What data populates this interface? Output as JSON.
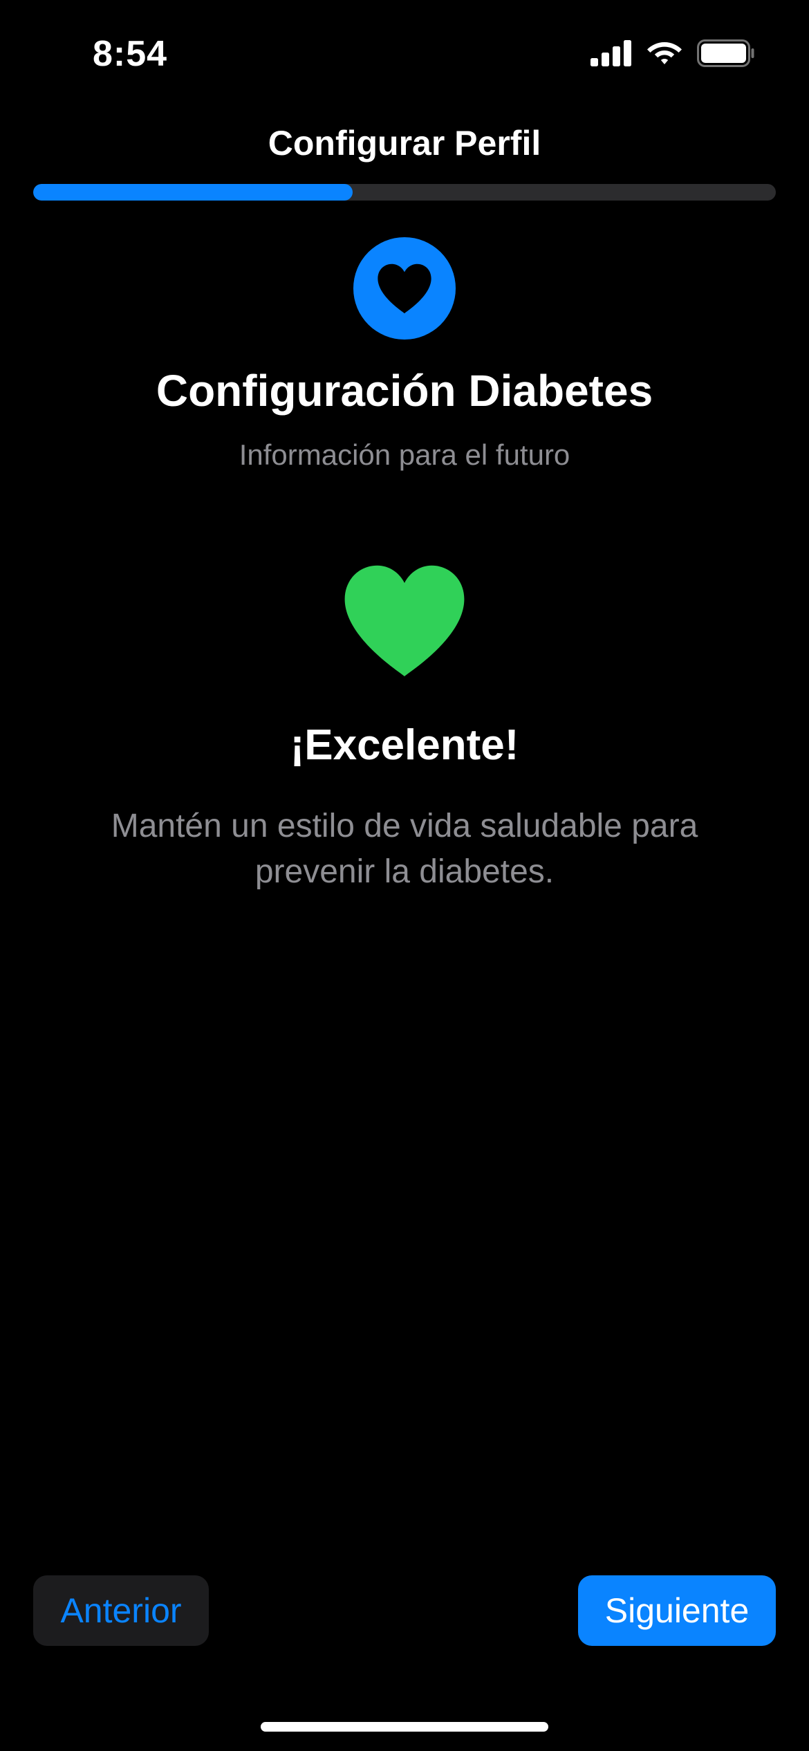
{
  "status_bar": {
    "time": "8:54",
    "icons": [
      "cellular-signal-icon",
      "wifi-icon",
      "battery-icon"
    ]
  },
  "nav": {
    "title": "Configurar Perfil"
  },
  "progress": {
    "fraction": 0.43,
    "fill_color": "#0a84ff",
    "track_color": "#2c2c2e"
  },
  "header": {
    "icon": "heart-icon",
    "icon_background": "#0a84ff",
    "title": "Configuración Diabetes",
    "subtitle": "Información para el futuro"
  },
  "result": {
    "icon": "heart-icon",
    "icon_color": "#30d158",
    "title": "¡Excelente!",
    "message": "Mantén un estilo de vida saludable para prevenir la diabetes."
  },
  "buttons": {
    "previous_label": "Anterior",
    "next_label": "Siguiente"
  },
  "colors": {
    "background": "#000000",
    "accent": "#0a84ff",
    "success": "#30d158",
    "secondary_text": "#8e8e93"
  }
}
